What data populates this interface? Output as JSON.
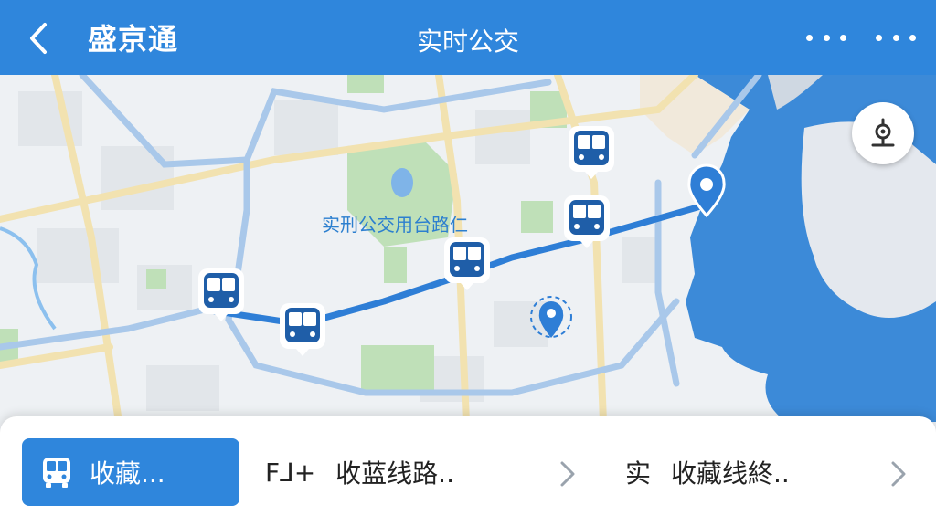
{
  "header": {
    "app_title": "盛京通",
    "page_title": "实时公交",
    "back_icon": "chevron-left-icon",
    "more_icon": "more-dots-icon"
  },
  "map": {
    "label": "实刑公交用台路仁",
    "markers": [
      "bus-icon",
      "bus-icon",
      "bus-icon",
      "bus-icon",
      "bus-icon"
    ],
    "pins": [
      "location-pin-icon",
      "location-pin-icon"
    ],
    "locate_icon": "locate-target-icon"
  },
  "bottom": {
    "favorite": {
      "label": "收藏...",
      "icon": "bus-icon"
    },
    "routes": [
      {
        "prefix": "F⅃+",
        "label": "收蓝线路.."
      },
      {
        "prefix": "实",
        "label": "收藏线終.."
      }
    ]
  },
  "colors": {
    "primary": "#2f86dc",
    "marker": "#1f5ea8",
    "water": "#3c8ad8",
    "park": "#bfe0b8"
  }
}
